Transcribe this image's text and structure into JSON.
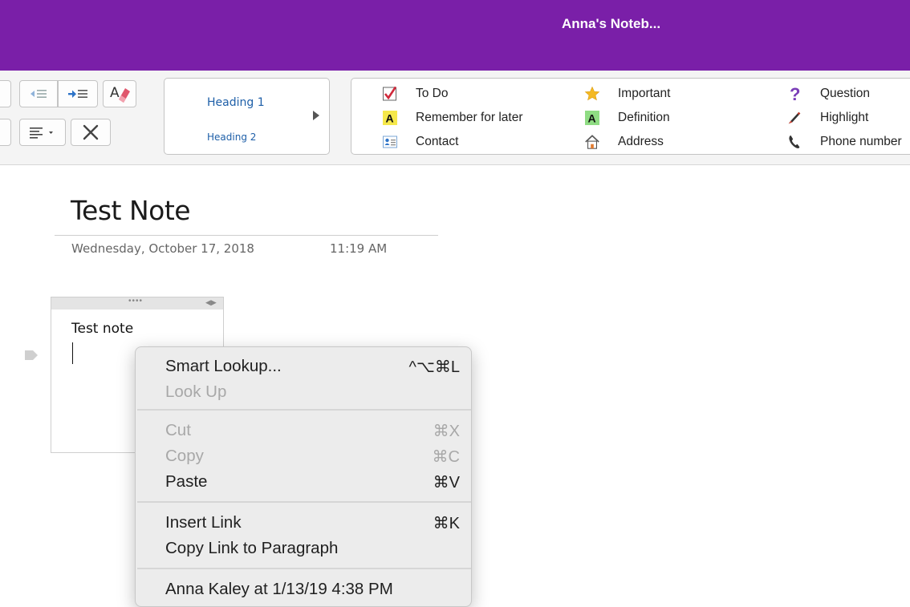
{
  "window": {
    "title": "Anna's Noteb..."
  },
  "ribbon": {
    "buttons": {
      "decrease_indent": "decrease-indent-icon",
      "increase_indent": "increase-indent-icon",
      "clear_formatting": "clear-formatting-icon",
      "paragraph_alignment": "align-left-icon",
      "delete": "close-icon"
    },
    "styles": {
      "heading1": "Heading 1",
      "heading2": "Heading 2"
    },
    "tags": [
      {
        "label": "To Do",
        "icon": "checkbox-icon"
      },
      {
        "label": "Remember for later",
        "icon": "highlight-a-yellow-icon"
      },
      {
        "label": "Contact",
        "icon": "contact-card-icon"
      },
      {
        "label": "Important",
        "icon": "star-icon"
      },
      {
        "label": "Definition",
        "icon": "highlight-a-green-icon"
      },
      {
        "label": "Address",
        "icon": "house-icon"
      },
      {
        "label": "Question",
        "icon": "question-mark-icon"
      },
      {
        "label": "Highlight",
        "icon": "marker-icon"
      },
      {
        "label": "Phone number",
        "icon": "phone-icon"
      }
    ]
  },
  "page": {
    "title": "Test Note",
    "date": "Wednesday, October 17, 2018",
    "time": "11:19 AM",
    "note": {
      "text": "Test note"
    }
  },
  "context_menu": {
    "items": [
      {
        "label": "Smart Lookup...",
        "shortcut": "^⌥⌘L",
        "enabled": true
      },
      {
        "label": "Look Up",
        "shortcut": "",
        "enabled": false
      },
      {
        "label": "Cut",
        "shortcut": "⌘X",
        "enabled": false
      },
      {
        "label": "Copy",
        "shortcut": "⌘C",
        "enabled": false
      },
      {
        "label": "Paste",
        "shortcut": "⌘V",
        "enabled": true
      },
      {
        "label": "Insert Link",
        "shortcut": "⌘K",
        "enabled": true
      },
      {
        "label": "Copy Link to Paragraph",
        "shortcut": "",
        "enabled": true
      },
      {
        "label": "Anna Kaley at 1/13/19 4:38 PM",
        "shortcut": "",
        "enabled": true
      }
    ]
  }
}
